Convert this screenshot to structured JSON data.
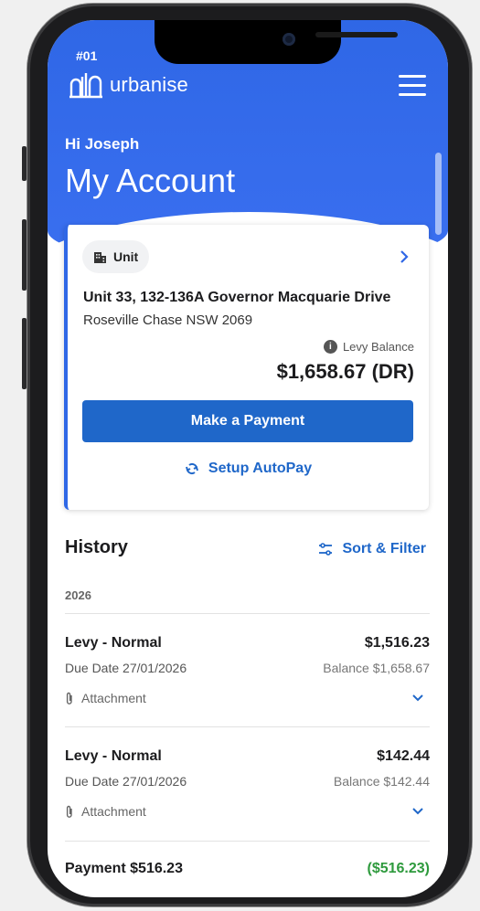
{
  "header": {
    "code": "#01",
    "brand": "urbanise",
    "greeting": "Hi Joseph",
    "title": "My Account"
  },
  "account_card": {
    "chip_label": "Unit",
    "address_line1": "Unit 33, 132-136A Governor Macquarie Drive",
    "address_line2": "Roseville Chase NSW 2069",
    "levy_label": "Levy Balance",
    "levy_amount": "$1,658.67 (DR)",
    "pay_button": "Make a Payment",
    "autopay_button": "Setup AutoPay"
  },
  "history": {
    "title": "History",
    "sort_filter": "Sort & Filter",
    "year": "2026",
    "items": [
      {
        "title": "Levy - Normal",
        "amount": "$1,516.23",
        "due": "Due Date 27/01/2026",
        "balance": "Balance $1,658.67",
        "attachment": "Attachment"
      },
      {
        "title": "Levy - Normal",
        "amount": "$142.44",
        "due": "Due Date 27/01/2026",
        "balance": "Balance $142.44",
        "attachment": "Attachment"
      }
    ],
    "payment": {
      "title": "Payment $516.23",
      "amount": "($516.23)"
    }
  },
  "colors": {
    "brand_blue": "#2f67e6",
    "button_blue": "#1f67c9",
    "credit_green": "#2e9a3d"
  },
  "icons": {
    "logo": "urbanise-logo-icon",
    "menu": "hamburger-menu-icon",
    "unit": "building-icon",
    "chevron": "chevron-right-icon",
    "info": "info-icon",
    "autopay": "refresh-icon",
    "filter": "filter-sliders-icon",
    "attachment": "paperclip-icon",
    "expand": "chevron-down-icon"
  }
}
